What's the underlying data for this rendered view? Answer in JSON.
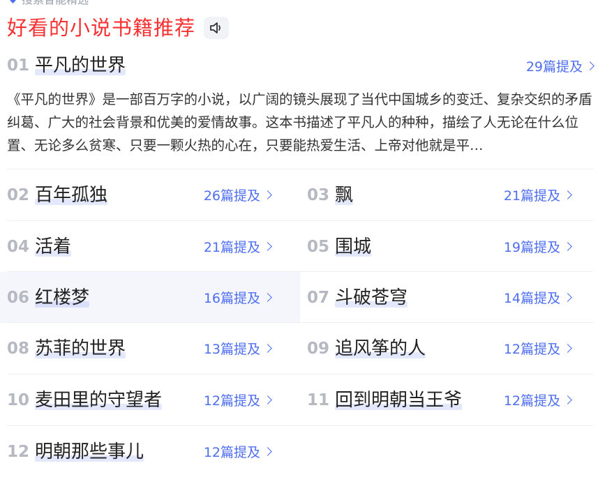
{
  "header": {
    "top_cut_text": "搜索智能精选",
    "title": "好看的小说书籍推荐"
  },
  "top_item": {
    "rank": "01",
    "name": "平凡的世界",
    "mentions": "29篇提及",
    "description": "《平凡的世界》是一部百万字的小说，以广阔的镜头展现了当代中国城乡的变迁、复杂交织的矛盾纠葛、广大的社会背景和优美的爱情故事。这本书描述了平凡人的种种，描绘了人无论在什么位置、无论多么贫寒、只要一颗火热的心在，只要能热爱生活、上帝对他就是平…"
  },
  "items": [
    {
      "rank": "02",
      "name": "百年孤独",
      "mentions": "26篇提及"
    },
    {
      "rank": "03",
      "name": "飘",
      "mentions": "21篇提及"
    },
    {
      "rank": "04",
      "name": "活着",
      "mentions": "21篇提及"
    },
    {
      "rank": "05",
      "name": "围城",
      "mentions": "19篇提及"
    },
    {
      "rank": "06",
      "name": "红楼梦",
      "mentions": "16篇提及"
    },
    {
      "rank": "07",
      "name": "斗破苍穹",
      "mentions": "14篇提及"
    },
    {
      "rank": "08",
      "name": "苏菲的世界",
      "mentions": "13篇提及"
    },
    {
      "rank": "09",
      "name": "追风筝的人",
      "mentions": "12篇提及"
    },
    {
      "rank": "10",
      "name": "麦田里的守望者",
      "mentions": "12篇提及"
    },
    {
      "rank": "11",
      "name": "回到明朝当王爷",
      "mentions": "12篇提及"
    },
    {
      "rank": "12",
      "name": "明朝那些事儿",
      "mentions": "12篇提及"
    }
  ],
  "colors": {
    "title": "#f73131",
    "link": "#4e6ef2",
    "rank": "#b6b9c2",
    "highlight_row": "#f5f6fb"
  }
}
